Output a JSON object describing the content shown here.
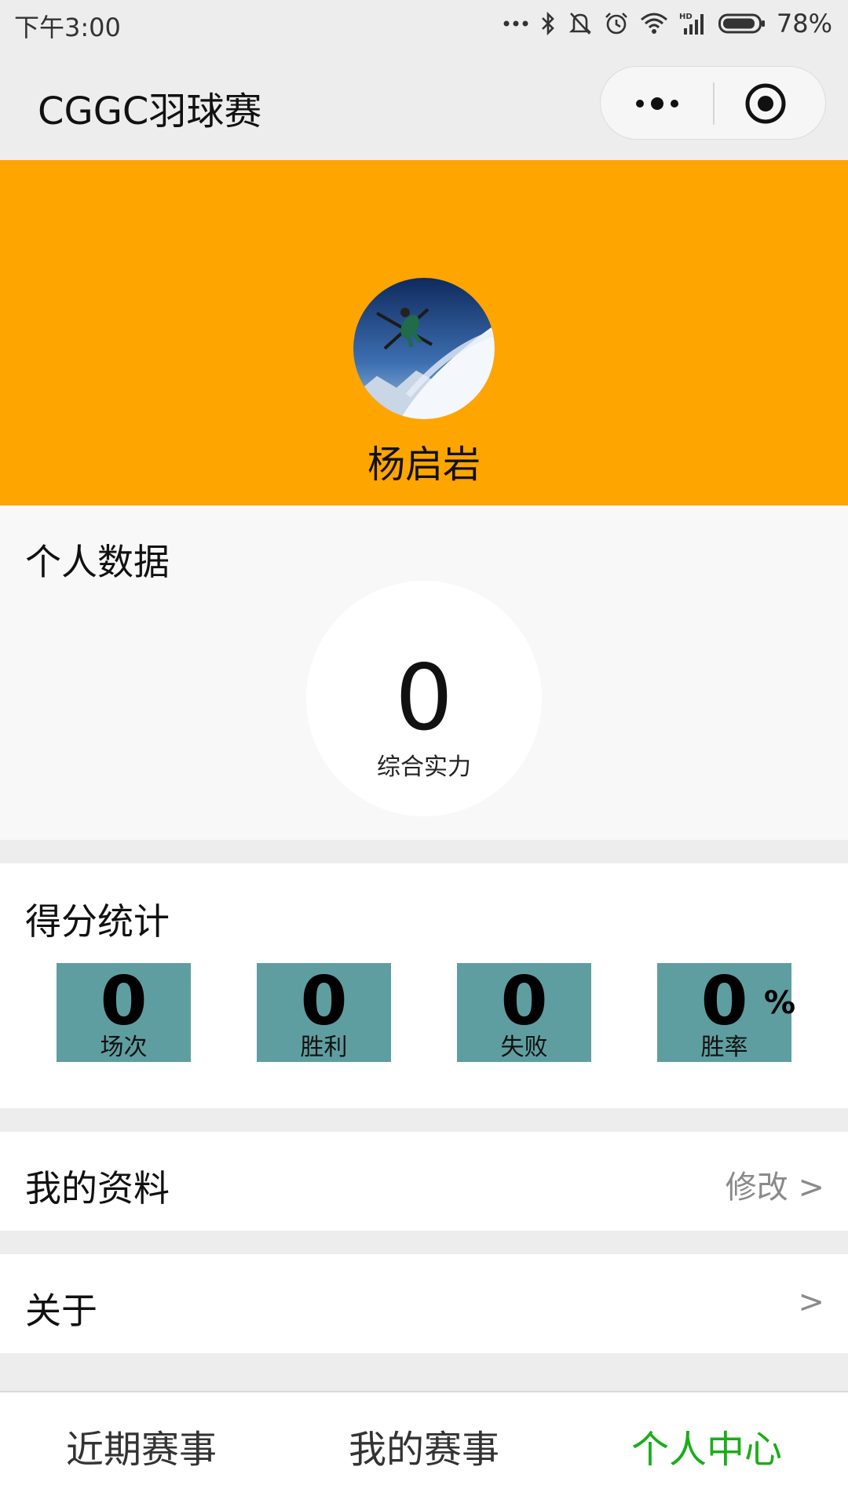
{
  "status_bar": {
    "time": "下午3:00",
    "battery": "78%",
    "icons": [
      "more-dots-icon",
      "bluetooth-icon",
      "mute-bell-icon",
      "alarm-icon",
      "wifi-icon",
      "hd-signal-icon",
      "battery-icon"
    ]
  },
  "nav": {
    "title": "CGGC羽球赛",
    "capsule_icons": [
      "more-icon",
      "close-target-icon"
    ]
  },
  "profile": {
    "name": "杨启岩",
    "avatar_icon": "skier-photo-avatar"
  },
  "personal": {
    "title": "个人数据",
    "strength_value": "0",
    "strength_label": "综合实力"
  },
  "score": {
    "title": "得分统计",
    "stats": [
      {
        "value": "0",
        "label": "场次"
      },
      {
        "value": "0",
        "label": "胜利"
      },
      {
        "value": "0",
        "label": "失败"
      },
      {
        "value": "0",
        "label": "胜率",
        "unit": "%"
      }
    ]
  },
  "rows": {
    "profile_label": "我的资料",
    "profile_action": "修改 >",
    "about_label": "关于",
    "about_action": ">"
  },
  "tabs": [
    {
      "label": "近期赛事"
    },
    {
      "label": "我的赛事"
    },
    {
      "label": "个人中心"
    }
  ],
  "colors": {
    "header_bg": "#ffa500",
    "stat_box_bg": "#5f9ea0",
    "tab_active": "#1aad19",
    "tab_inactive": "#333333",
    "page_bg": "#ededed"
  }
}
